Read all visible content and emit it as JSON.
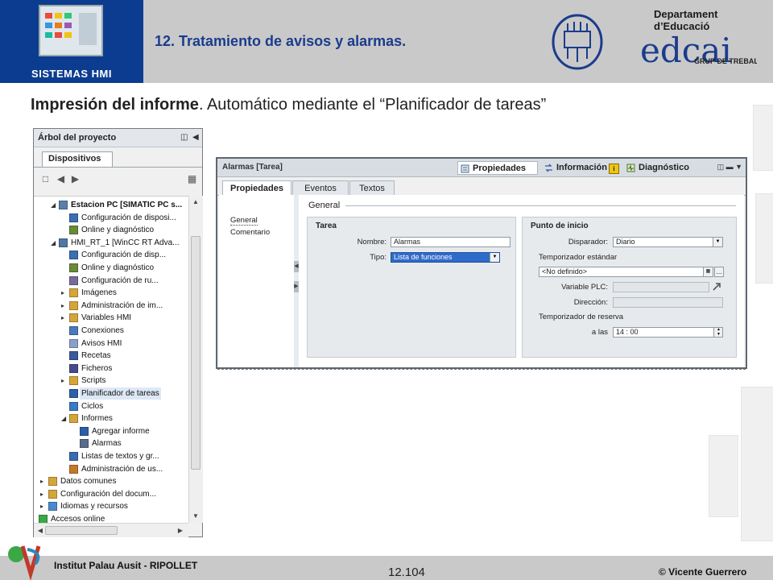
{
  "slide": {
    "logo_caption": "SISTEMAS HMI",
    "title": "12. Tratamiento de avisos y alarmas.",
    "department": "Departament d’Educació",
    "brand": "edcai",
    "brand_sub": "GRUP DE TREBALL",
    "subtitle_bold": "Impresión del informe",
    "subtitle_rest": ". Automático mediante el “Planificador de tareas”",
    "institute": "Institut Palau Ausit - RIPOLLET",
    "page_number": "12.104",
    "author": "© Vicente Guerrero"
  },
  "tree": {
    "title": "Árbol del proyecto",
    "tab": "Dispositivos",
    "items": [
      {
        "label": "Estacion PC [SIMATIC PC s...",
        "bold": true
      },
      {
        "label": "Configuración de disposi..."
      },
      {
        "label": "Online y diagnóstico"
      },
      {
        "label": "HMI_RT_1 [WinCC RT Adva..."
      },
      {
        "label": "Configuración de disp..."
      },
      {
        "label": "Online y diagnóstico"
      },
      {
        "label": "Configuración de ru..."
      },
      {
        "label": "Imágenes"
      },
      {
        "label": "Administración de im..."
      },
      {
        "label": "Variables HMI"
      },
      {
        "label": "Conexiones"
      },
      {
        "label": "Avisos HMI"
      },
      {
        "label": "Recetas"
      },
      {
        "label": "Ficheros"
      },
      {
        "label": "Scripts"
      },
      {
        "label": "Planificador de tareas"
      },
      {
        "label": "Ciclos"
      },
      {
        "label": "Informes"
      },
      {
        "label": "Agregar informe"
      },
      {
        "label": "Alarmas"
      },
      {
        "label": "Listas de textos y gr..."
      },
      {
        "label": "Administración de us..."
      },
      {
        "label": "Datos comunes"
      },
      {
        "label": "Configuración del docum..."
      },
      {
        "label": "Idiomas y recursos"
      },
      {
        "label": "Accesos online"
      }
    ]
  },
  "props": {
    "window_title": "Alarmas [Tarea]",
    "tab_properties": "Propiedades",
    "tab_info": "Información",
    "info_badge": "i",
    "tab_diag": "Diagnóstico",
    "subtabs": [
      "Propiedades",
      "Eventos",
      "Textos"
    ],
    "nav": [
      "General",
      "Comentario"
    ],
    "section": "General",
    "tarea": {
      "title": "Tarea",
      "name_label": "Nombre:",
      "name_value": "Alarmas",
      "type_label": "Tipo:",
      "type_value": "Lista de funciones"
    },
    "inicio": {
      "title": "Punto de inicio",
      "trigger_label": "Disparador:",
      "trigger_value": "Diario",
      "std_timer": "Temporizador estándar",
      "std_value": "<No definido>",
      "plc_var_label": "Variable PLC:",
      "address_label": "Dirección:",
      "reserve_timer": "Temporizador de reserva",
      "at_label": "a las",
      "time_value": "14 : 00",
      "browse": "..."
    }
  },
  "colors": {
    "logo_blue": "#0c3c8f",
    "title_blue": "#1a3c8c",
    "band_gray": "#c9c9c9",
    "selection_blue": "#2f6bc9"
  }
}
